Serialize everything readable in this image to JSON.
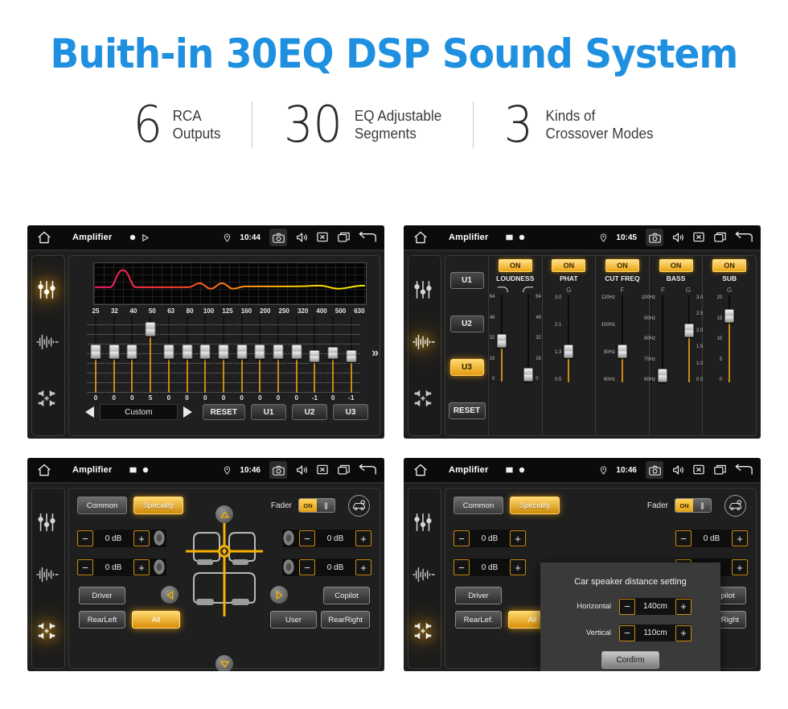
{
  "hero": {
    "title": "Buith-in 30EQ DSP Sound System",
    "accent_color": "#1f8fe0"
  },
  "stats": [
    {
      "number": "6",
      "line1": "RCA",
      "line2": "Outputs"
    },
    {
      "number": "30",
      "line1": "EQ Adjustable",
      "line2": "Segments"
    },
    {
      "number": "3",
      "line1": "Kinds of",
      "line2": "Crossover Modes"
    }
  ],
  "panels": {
    "eq": {
      "statusbar": {
        "title": "Amplifier",
        "time": "10:44"
      },
      "sidebar": [
        "eq-sliders-icon",
        "waveform-icon",
        "balance-icon"
      ],
      "active_sidebar": 0,
      "graph": {
        "curve_colors": [
          "#f0176b",
          "#ff7a18",
          "#f3e600"
        ]
      },
      "bands": [
        {
          "freq": "25",
          "value": "0"
        },
        {
          "freq": "32",
          "value": "0"
        },
        {
          "freq": "40",
          "value": "0"
        },
        {
          "freq": "50",
          "value": "5"
        },
        {
          "freq": "63",
          "value": "0"
        },
        {
          "freq": "80",
          "value": "0"
        },
        {
          "freq": "100",
          "value": "0"
        },
        {
          "freq": "125",
          "value": "0"
        },
        {
          "freq": "160",
          "value": "0"
        },
        {
          "freq": "200",
          "value": "0"
        },
        {
          "freq": "250",
          "value": "0"
        },
        {
          "freq": "320",
          "value": "0"
        },
        {
          "freq": "400",
          "value": "-1"
        },
        {
          "freq": "500",
          "value": "0"
        },
        {
          "freq": "630",
          "value": "-1"
        }
      ],
      "more_label": "»",
      "preset": "Custom",
      "reset_label": "RESET",
      "user_presets": [
        "U1",
        "U2",
        "U3"
      ]
    },
    "effects": {
      "statusbar": {
        "title": "Amplifier",
        "time": "10:45"
      },
      "active_sidebar": 1,
      "presets": [
        "U1",
        "U2",
        "U3"
      ],
      "selected_preset": "U3",
      "reset_label": "RESET",
      "columns": [
        {
          "name": "LOUDNESS",
          "state": "ON",
          "sliders": [
            {
              "axis": "",
              "ticks": [
                "64",
                "48",
                "32",
                "16",
                "0"
              ],
              "value": "32"
            },
            {
              "axis": "",
              "ticks": [
                "64",
                "48",
                "32",
                "16",
                "0"
              ],
              "value": "6"
            }
          ]
        },
        {
          "name": "PHAT",
          "state": "ON",
          "sliders": [
            {
              "axis": "G",
              "ticks": [
                "3.0",
                "2.1",
                "1.3",
                "0.5"
              ],
              "value": "1.3"
            }
          ]
        },
        {
          "name": "CUT FREQ",
          "state": "ON",
          "sliders": [
            {
              "axis": "F",
              "ticks": [
                "120Hz",
                "100Hz",
                "80Hz",
                "60Hz"
              ],
              "value": "80Hz"
            }
          ]
        },
        {
          "name": "BASS",
          "state": "ON",
          "sliders": [
            {
              "axis": "F",
              "ticks": [
                "100Hz",
                "90Hz",
                "80Hz",
                "70Hz",
                "60Hz"
              ],
              "value": "60Hz"
            },
            {
              "axis": "G",
              "ticks": [
                "3.0",
                "2.5",
                "2.0",
                "1.5",
                "1.0",
                "0.5"
              ],
              "value": "2.0"
            }
          ]
        },
        {
          "name": "SUB",
          "state": "ON",
          "sliders": [
            {
              "axis": "G",
              "ticks": [
                "20",
                "15",
                "10",
                "5",
                "0"
              ],
              "value": "15"
            }
          ]
        }
      ]
    },
    "fader": {
      "statusbar": {
        "title": "Amplifier",
        "time": "10:46"
      },
      "active_sidebar": 2,
      "tabs": [
        {
          "label": "Common",
          "selected": false
        },
        {
          "label": "Specialty",
          "selected": true
        }
      ],
      "fader_label": "Fader",
      "fader_state": "ON",
      "car_settings_icon": "car-gear-icon",
      "gains": [
        {
          "position": "front-left",
          "value": "0 dB"
        },
        {
          "position": "front-right",
          "value": "0 dB"
        },
        {
          "position": "rear-left",
          "value": "0 dB"
        },
        {
          "position": "rear-right",
          "value": "0 dB"
        }
      ],
      "minus": "−",
      "plus": "+",
      "seat_buttons": [
        {
          "label": "Driver",
          "selected": false
        },
        {
          "label": "Copilot",
          "selected": false
        },
        {
          "label": "RearLeft",
          "selected": false
        },
        {
          "label": "All",
          "selected": true
        },
        {
          "label": "User",
          "selected": false
        },
        {
          "label": "RearRight",
          "selected": false
        }
      ]
    },
    "fader_dialog": {
      "statusbar": {
        "title": "Amplifier",
        "time": "10:46"
      },
      "active_sidebar": 2,
      "tabs": [
        {
          "label": "Common",
          "selected": false
        },
        {
          "label": "Specialty",
          "selected": true
        }
      ],
      "fader_label": "Fader",
      "fader_state": "ON",
      "modal": {
        "title": "Car speaker distance setting",
        "rows": [
          {
            "label": "Horizontal",
            "value": "140cm"
          },
          {
            "label": "Vertical",
            "value": "110cm"
          }
        ],
        "confirm_label": "Confirm",
        "minus": "−",
        "plus": "+"
      },
      "gains": [
        {
          "position": "front-left",
          "value": "0 dB"
        },
        {
          "position": "front-right",
          "value": "0 dB"
        },
        {
          "position": "rear-left",
          "value": "0 dB"
        },
        {
          "position": "rear-right",
          "value": "0 dB"
        }
      ],
      "seat_buttons": [
        {
          "label": "Driver",
          "selected": false
        },
        {
          "label": "Copilot",
          "selected": false
        },
        {
          "label": "RearLef.",
          "selected": false
        },
        {
          "label": "All",
          "selected": true
        },
        {
          "label": "User",
          "selected": false
        },
        {
          "label": "RearRight",
          "selected": false
        }
      ]
    }
  }
}
